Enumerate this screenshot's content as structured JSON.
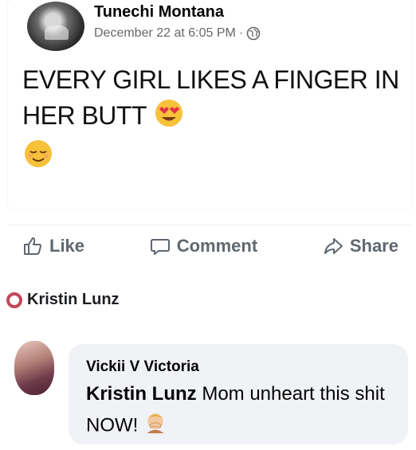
{
  "post": {
    "author": "Tunechi Montana",
    "timestamp": "December 22 at 6:05 PM",
    "separator": "·",
    "privacy_icon": "globe-icon",
    "text": "EVERY GIRL LIKES A FINGER IN HER BUTT",
    "emojis": [
      "heart-eyes-emoji",
      "relieved-face-emoji"
    ]
  },
  "actions": {
    "like_label": "Like",
    "comment_label": "Comment",
    "share_label": "Share"
  },
  "comment": {
    "replying_to": "Kristin Lunz",
    "author": "Vickii V Victoria",
    "mention": "Kristin Lunz",
    "text": "Mom unheart this shit NOW!",
    "emoji": "facepalm-emoji"
  },
  "colors": {
    "status_ring": "#c2485a",
    "bubble_bg": "#f0f2f5",
    "secondary_text": "#65676b"
  }
}
